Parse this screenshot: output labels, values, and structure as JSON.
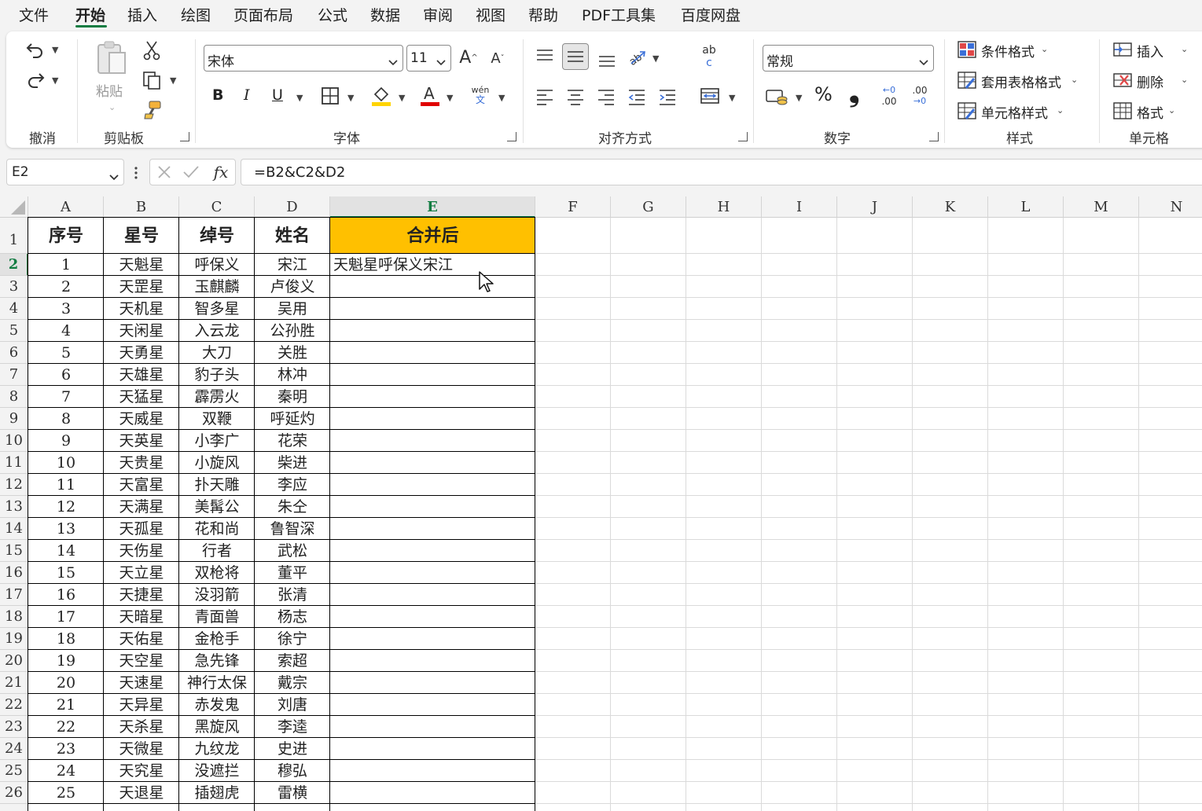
{
  "menu": {
    "tabs": [
      "文件",
      "开始",
      "插入",
      "绘图",
      "页面布局",
      "公式",
      "数据",
      "审阅",
      "视图",
      "帮助",
      "PDF工具集",
      "百度网盘"
    ],
    "active": "开始"
  },
  "ribbon": {
    "groups": {
      "undo": "撤消",
      "clipboard": "剪贴板",
      "font": "字体",
      "alignment": "对齐方式",
      "number": "数字",
      "styles": "样式",
      "cells": "单元格"
    },
    "paste_label": "粘贴",
    "font_name": "宋体",
    "font_size": "11",
    "bold": "B",
    "italic": "I",
    "underline": "U",
    "phonetic_top": "wén",
    "phonetic_bottom": "文",
    "wrap_top": "ab",
    "wrap_bottom": "c",
    "number_format": "常规",
    "percent": "%",
    "comma": "❟",
    "inc_decimal": ".00",
    "dec_decimal": ".00",
    "conditional_format": "条件格式",
    "format_as_table": "套用表格格式",
    "cell_styles": "单元格样式",
    "insert": "插入",
    "delete": "删除",
    "format": "格式"
  },
  "formula_bar": {
    "name_box": "E2",
    "fx": "fx",
    "formula": "=B2&C2&D2"
  },
  "sheet": {
    "columns": [
      "A",
      "B",
      "C",
      "D",
      "E",
      "F",
      "G",
      "H",
      "I",
      "J",
      "K",
      "L",
      "M",
      "N"
    ],
    "selected_column": "E",
    "selected_row": 2,
    "row_numbers": [
      "1",
      "2",
      "3",
      "4",
      "5",
      "6",
      "7",
      "8",
      "9",
      "10",
      "11",
      "12",
      "13",
      "14",
      "15",
      "16",
      "17",
      "18",
      "19",
      "20",
      "21",
      "22",
      "23",
      "24",
      "25",
      "26"
    ],
    "headers": [
      "序号",
      "星号",
      "绰号",
      "姓名",
      "合并后"
    ],
    "header_fill": "#ffc000",
    "rows": [
      [
        "1",
        "天魁星",
        "呼保义",
        "宋江",
        "天魁星呼保义宋江"
      ],
      [
        "2",
        "天罡星",
        "玉麒麟",
        "卢俊义",
        ""
      ],
      [
        "3",
        "天机星",
        "智多星",
        "吴用",
        ""
      ],
      [
        "4",
        "天闲星",
        "入云龙",
        "公孙胜",
        ""
      ],
      [
        "5",
        "天勇星",
        "大刀",
        "关胜",
        ""
      ],
      [
        "6",
        "天雄星",
        "豹子头",
        "林冲",
        ""
      ],
      [
        "7",
        "天猛星",
        "霹雳火",
        "秦明",
        ""
      ],
      [
        "8",
        "天威星",
        "双鞭",
        "呼延灼",
        ""
      ],
      [
        "9",
        "天英星",
        "小李广",
        "花荣",
        ""
      ],
      [
        "10",
        "天贵星",
        "小旋风",
        "柴进",
        ""
      ],
      [
        "11",
        "天富星",
        "扑天雕",
        "李应",
        ""
      ],
      [
        "12",
        "天满星",
        "美髯公",
        "朱仝",
        ""
      ],
      [
        "13",
        "天孤星",
        "花和尚",
        "鲁智深",
        ""
      ],
      [
        "14",
        "天伤星",
        "行者",
        "武松",
        ""
      ],
      [
        "15",
        "天立星",
        "双枪将",
        "董平",
        ""
      ],
      [
        "16",
        "天捷星",
        "没羽箭",
        "张清",
        ""
      ],
      [
        "17",
        "天暗星",
        "青面兽",
        "杨志",
        ""
      ],
      [
        "18",
        "天佑星",
        "金枪手",
        "徐宁",
        ""
      ],
      [
        "19",
        "天空星",
        "急先锋",
        "索超",
        ""
      ],
      [
        "20",
        "天速星",
        "神行太保",
        "戴宗",
        ""
      ],
      [
        "21",
        "天异星",
        "赤发鬼",
        "刘唐",
        ""
      ],
      [
        "22",
        "天杀星",
        "黑旋风",
        "李逵",
        ""
      ],
      [
        "23",
        "天微星",
        "九纹龙",
        "史进",
        ""
      ],
      [
        "24",
        "天究星",
        "没遮拦",
        "穆弘",
        ""
      ],
      [
        "25",
        "天退星",
        "插翅虎",
        "雷横",
        ""
      ]
    ]
  }
}
